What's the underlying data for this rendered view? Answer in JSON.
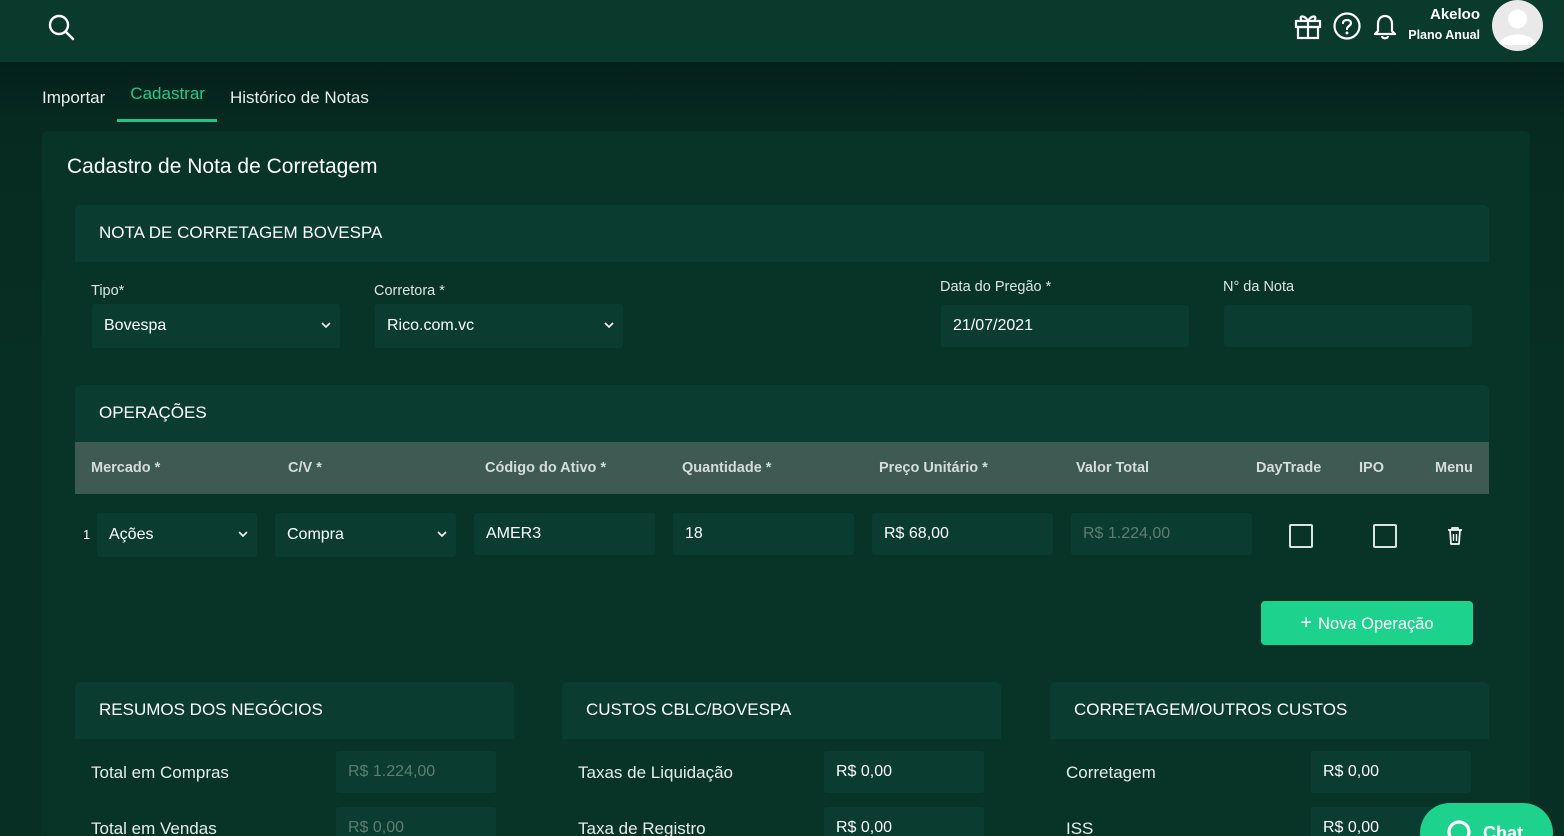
{
  "header": {
    "user_name": "Akeloo",
    "user_plan": "Plano Anual",
    "icons": [
      "search-icon",
      "gift-icon",
      "help-icon",
      "bell-icon",
      "avatar"
    ]
  },
  "tabs": [
    {
      "label": "Importar",
      "active": false
    },
    {
      "label": "Cadastrar",
      "active": true
    },
    {
      "label": "Histórico de Notas",
      "active": false
    }
  ],
  "page_title": "Cadastro de Nota de Corretagem",
  "nota": {
    "section_title": "NOTA DE CORRETAGEM BOVESPA",
    "tipo_label": "Tipo*",
    "tipo_value": "Bovespa",
    "corretora_label": "Corretora *",
    "corretora_value": "Rico.com.vc",
    "data_label": "Data do Pregão *",
    "data_value": "21/07/2021",
    "numero_label": "N° da Nota",
    "numero_value": ""
  },
  "operacoes": {
    "section_title": "OPERAÇÕES",
    "columns": [
      "Mercado *",
      "C/V *",
      "Código do Ativo *",
      "Quantidade *",
      "Preço Unitário *",
      "Valor Total",
      "DayTrade",
      "IPO",
      "Menu"
    ],
    "rows": [
      {
        "index": "1",
        "mercado": "Ações",
        "cv": "Compra",
        "codigo": "AMER3",
        "quantidade": "18",
        "preco": "R$ 68,00",
        "valor_total": "R$ 1.224,00",
        "daytrade": false,
        "ipo": false
      }
    ],
    "add_button": "Nova Operação"
  },
  "resumos": {
    "title": "RESUMOS DOS NEGÓCIOS",
    "rows": [
      {
        "label": "Total em Compras",
        "value": "R$ 1.224,00"
      },
      {
        "label": "Total em Vendas",
        "value": "R$ 0,00"
      }
    ]
  },
  "custos": {
    "title": "CUSTOS CBLC/BOVESPA",
    "rows": [
      {
        "label": "Taxas de Liquidação",
        "value": "R$ 0,00"
      },
      {
        "label": "Taxa de Registro",
        "value": "R$ 0,00"
      }
    ]
  },
  "corretagem": {
    "title": "CORRETAGEM/OUTROS CUSTOS",
    "rows": [
      {
        "label": "Corretagem",
        "value": "R$ 0,00"
      },
      {
        "label": "ISS",
        "value": "R$ 0,00"
      }
    ]
  },
  "chat": {
    "label": "Chat"
  },
  "colors": {
    "accent": "#1dd28d",
    "tab_active": "#21c98a",
    "background": "#06251b",
    "card": "#083428"
  }
}
